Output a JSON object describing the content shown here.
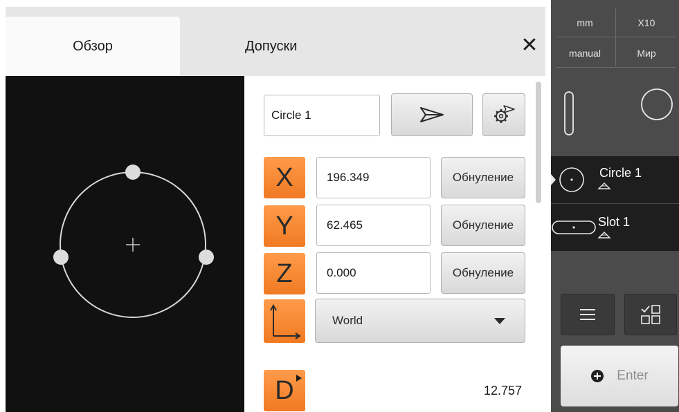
{
  "tabs": {
    "overview_label": "Обзор",
    "tolerances_label": "Допуски",
    "close_symbol": "✕"
  },
  "form": {
    "feature_name": "Circle 1",
    "send_icon": "send-icon",
    "settings_icon": "gear-send-icon",
    "rows": [
      {
        "axis": "X",
        "value": "196.349",
        "button": "Обнуление"
      },
      {
        "axis": "Y",
        "value": "62.465",
        "button": "Обнуление"
      },
      {
        "axis": "Z",
        "value": "0.000",
        "button": "Обнуление"
      }
    ],
    "coord_system": {
      "selected": "World"
    },
    "diameter": {
      "axis": "D",
      "value": "12.757"
    }
  },
  "sidebar": {
    "unit": "mm",
    "zoom": "X10",
    "mode": "manual",
    "coord": "Мир",
    "features": [
      {
        "label": "Circle 1",
        "icon": "circle-feature-icon"
      },
      {
        "label": "Slot 1",
        "icon": "slot-feature-icon"
      }
    ],
    "enter_label": "Enter"
  },
  "colors": {
    "accent_orange": "#f28a33",
    "sidebar_bg": "#4b4b4b",
    "preview_bg": "#111111"
  }
}
